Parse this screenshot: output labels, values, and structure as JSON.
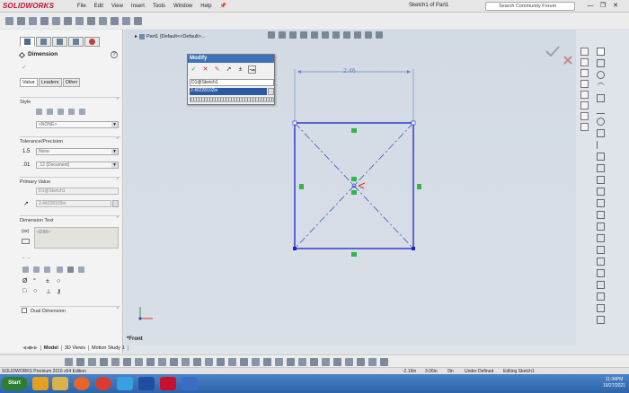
{
  "app": {
    "logo": "SOLIDWORKS",
    "menu": [
      "File",
      "Edit",
      "View",
      "Insert",
      "Tools",
      "Window",
      "Help"
    ],
    "document_title": "Sketch1 of Part1",
    "search_placeholder": "Search Community Forum"
  },
  "feature_tree_node": "Part1 (Default<<Default>...",
  "property_manager": {
    "title": "Dimension",
    "subtabs": [
      "Value",
      "Leaders",
      "Other"
    ],
    "style": {
      "title": "Style",
      "combo": "<NONE>"
    },
    "tolerance": {
      "title": "Tolerance/Precision",
      "tolerance_value": "None",
      "precision_value": ".12 (Document)"
    },
    "primary_value": {
      "title": "Primary Value",
      "name": "D1@Sketch1",
      "value": "2.46228102in"
    },
    "dimension_text": {
      "title": "Dimension Text",
      "text": "<DIM>"
    },
    "dual_dimension": {
      "title": "Dual Dimension"
    }
  },
  "modify_dialog": {
    "title": "Modify",
    "name": "D1@Sketch1",
    "value": "2.46228102in"
  },
  "sketch": {
    "dimension_label": "2.46",
    "line_color": "#1a22d0",
    "construction_color": "#3a55c7",
    "relation_color": "#2db84a"
  },
  "view_label": "*Front",
  "bottom_tabs": [
    "Model",
    "3D Views",
    "Motion Study 1"
  ],
  "status": {
    "edition": "SOLIDWORKS Premium 2016 x64 Edition",
    "x": "-2.19in",
    "y": "3.06in",
    "z": "0in",
    "state": "Under Defined",
    "editing": "Editing Sketch1"
  },
  "taskbar": {
    "start": "Start",
    "time": "11:34PM",
    "date": "10/27/2021"
  }
}
